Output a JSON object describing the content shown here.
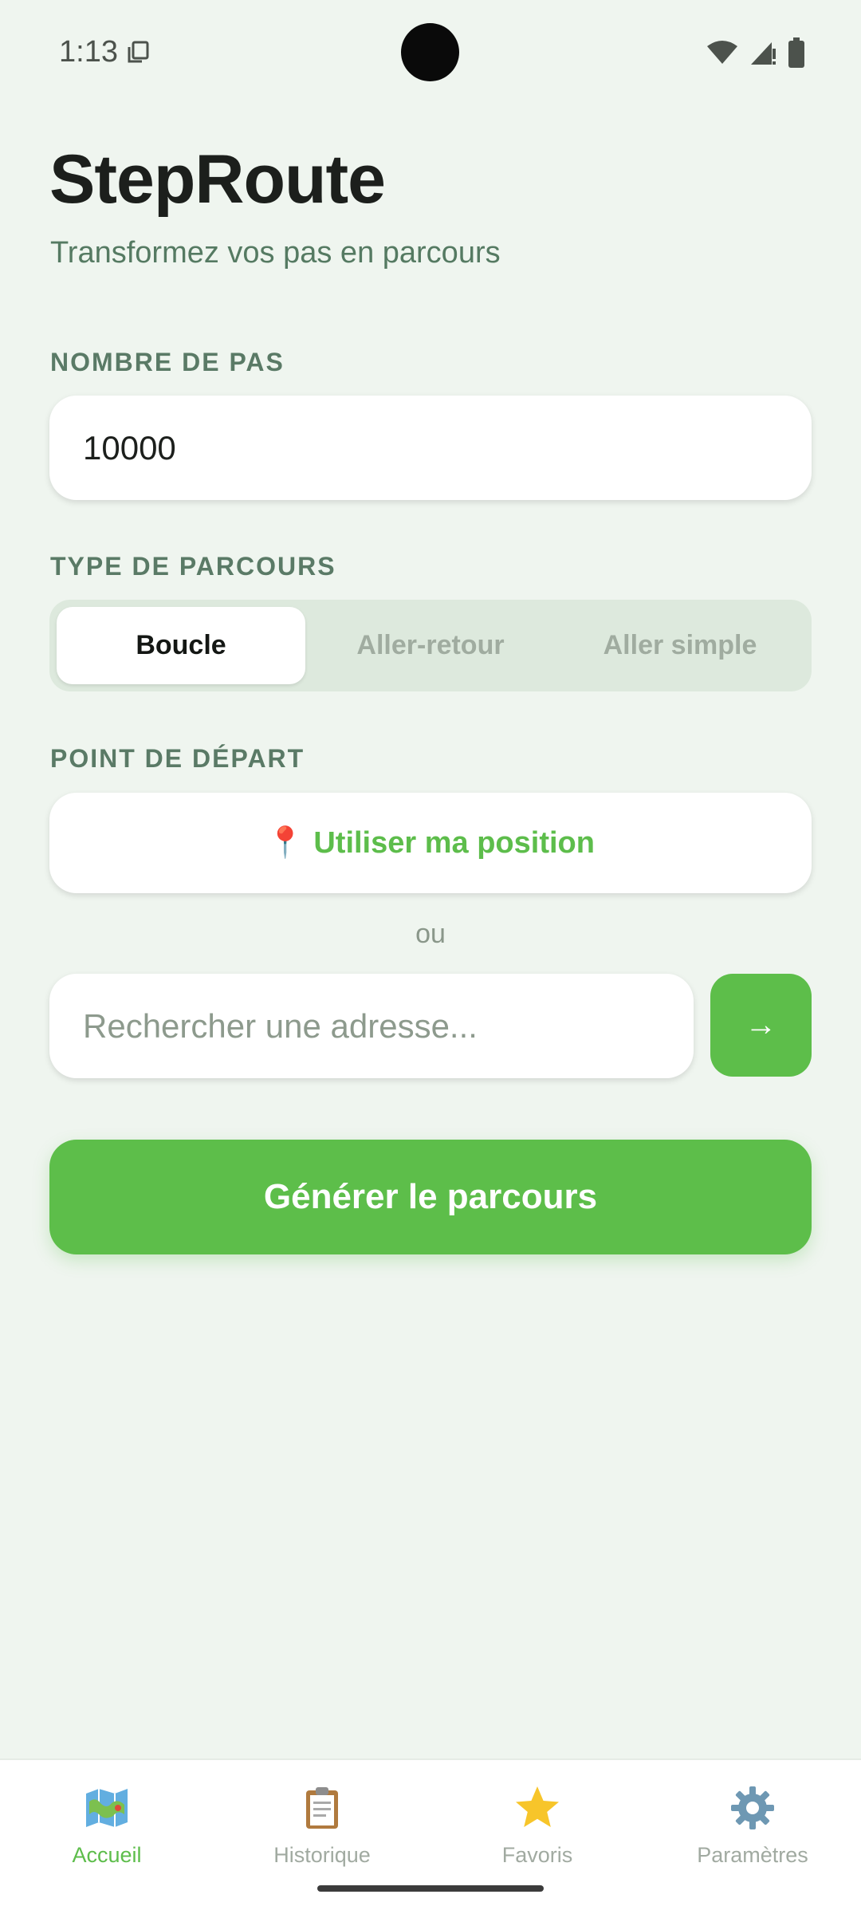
{
  "status_bar": {
    "time": "1:13"
  },
  "header": {
    "title": "StepRoute",
    "subtitle": "Transformez vos pas en parcours"
  },
  "steps": {
    "label": "NOMBRE DE PAS",
    "value": "10000"
  },
  "route_type": {
    "label": "TYPE DE PARCOURS",
    "options": [
      "Boucle",
      "Aller-retour",
      "Aller simple"
    ],
    "selected": "Boucle"
  },
  "start": {
    "label": "POINT DE DÉPART",
    "use_position_icon": "📍",
    "use_position_label": "Utiliser ma position",
    "or_text": "ou",
    "search_placeholder": "Rechercher une adresse...",
    "go_label": "→"
  },
  "generate_label": "Générer le parcours",
  "nav": {
    "items": [
      {
        "label": "Accueil",
        "icon": "map-icon"
      },
      {
        "label": "Historique",
        "icon": "clipboard-icon"
      },
      {
        "label": "Favoris",
        "icon": "star-icon"
      },
      {
        "label": "Paramètres",
        "icon": "gear-icon"
      }
    ],
    "active": "Accueil"
  },
  "colors": {
    "accent": "#5dbe4a",
    "background": "#eff5ef",
    "label": "#5a7a66"
  }
}
